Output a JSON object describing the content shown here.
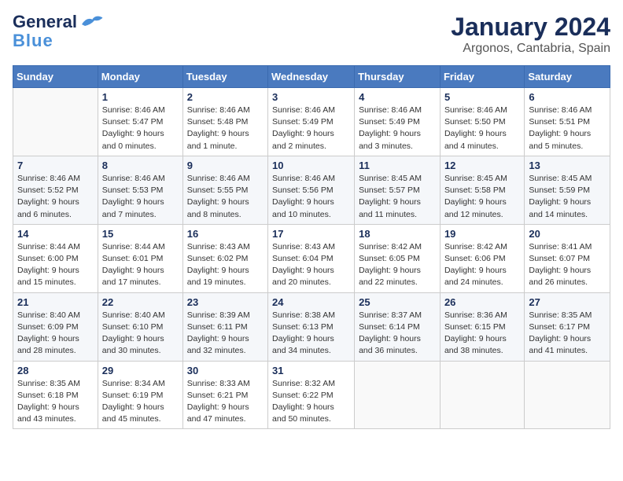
{
  "logo": {
    "line1": "General",
    "line2": "Blue"
  },
  "header": {
    "month": "January 2024",
    "location": "Argonos, Cantabria, Spain"
  },
  "weekdays": [
    "Sunday",
    "Monday",
    "Tuesday",
    "Wednesday",
    "Thursday",
    "Friday",
    "Saturday"
  ],
  "weeks": [
    [
      {
        "day": "",
        "info": ""
      },
      {
        "day": "1",
        "info": "Sunrise: 8:46 AM\nSunset: 5:47 PM\nDaylight: 9 hours\nand 0 minutes."
      },
      {
        "day": "2",
        "info": "Sunrise: 8:46 AM\nSunset: 5:48 PM\nDaylight: 9 hours\nand 1 minute."
      },
      {
        "day": "3",
        "info": "Sunrise: 8:46 AM\nSunset: 5:49 PM\nDaylight: 9 hours\nand 2 minutes."
      },
      {
        "day": "4",
        "info": "Sunrise: 8:46 AM\nSunset: 5:49 PM\nDaylight: 9 hours\nand 3 minutes."
      },
      {
        "day": "5",
        "info": "Sunrise: 8:46 AM\nSunset: 5:50 PM\nDaylight: 9 hours\nand 4 minutes."
      },
      {
        "day": "6",
        "info": "Sunrise: 8:46 AM\nSunset: 5:51 PM\nDaylight: 9 hours\nand 5 minutes."
      }
    ],
    [
      {
        "day": "7",
        "info": "Sunrise: 8:46 AM\nSunset: 5:52 PM\nDaylight: 9 hours\nand 6 minutes."
      },
      {
        "day": "8",
        "info": "Sunrise: 8:46 AM\nSunset: 5:53 PM\nDaylight: 9 hours\nand 7 minutes."
      },
      {
        "day": "9",
        "info": "Sunrise: 8:46 AM\nSunset: 5:55 PM\nDaylight: 9 hours\nand 8 minutes."
      },
      {
        "day": "10",
        "info": "Sunrise: 8:46 AM\nSunset: 5:56 PM\nDaylight: 9 hours\nand 10 minutes."
      },
      {
        "day": "11",
        "info": "Sunrise: 8:45 AM\nSunset: 5:57 PM\nDaylight: 9 hours\nand 11 minutes."
      },
      {
        "day": "12",
        "info": "Sunrise: 8:45 AM\nSunset: 5:58 PM\nDaylight: 9 hours\nand 12 minutes."
      },
      {
        "day": "13",
        "info": "Sunrise: 8:45 AM\nSunset: 5:59 PM\nDaylight: 9 hours\nand 14 minutes."
      }
    ],
    [
      {
        "day": "14",
        "info": "Sunrise: 8:44 AM\nSunset: 6:00 PM\nDaylight: 9 hours\nand 15 minutes."
      },
      {
        "day": "15",
        "info": "Sunrise: 8:44 AM\nSunset: 6:01 PM\nDaylight: 9 hours\nand 17 minutes."
      },
      {
        "day": "16",
        "info": "Sunrise: 8:43 AM\nSunset: 6:02 PM\nDaylight: 9 hours\nand 19 minutes."
      },
      {
        "day": "17",
        "info": "Sunrise: 8:43 AM\nSunset: 6:04 PM\nDaylight: 9 hours\nand 20 minutes."
      },
      {
        "day": "18",
        "info": "Sunrise: 8:42 AM\nSunset: 6:05 PM\nDaylight: 9 hours\nand 22 minutes."
      },
      {
        "day": "19",
        "info": "Sunrise: 8:42 AM\nSunset: 6:06 PM\nDaylight: 9 hours\nand 24 minutes."
      },
      {
        "day": "20",
        "info": "Sunrise: 8:41 AM\nSunset: 6:07 PM\nDaylight: 9 hours\nand 26 minutes."
      }
    ],
    [
      {
        "day": "21",
        "info": "Sunrise: 8:40 AM\nSunset: 6:09 PM\nDaylight: 9 hours\nand 28 minutes."
      },
      {
        "day": "22",
        "info": "Sunrise: 8:40 AM\nSunset: 6:10 PM\nDaylight: 9 hours\nand 30 minutes."
      },
      {
        "day": "23",
        "info": "Sunrise: 8:39 AM\nSunset: 6:11 PM\nDaylight: 9 hours\nand 32 minutes."
      },
      {
        "day": "24",
        "info": "Sunrise: 8:38 AM\nSunset: 6:13 PM\nDaylight: 9 hours\nand 34 minutes."
      },
      {
        "day": "25",
        "info": "Sunrise: 8:37 AM\nSunset: 6:14 PM\nDaylight: 9 hours\nand 36 minutes."
      },
      {
        "day": "26",
        "info": "Sunrise: 8:36 AM\nSunset: 6:15 PM\nDaylight: 9 hours\nand 38 minutes."
      },
      {
        "day": "27",
        "info": "Sunrise: 8:35 AM\nSunset: 6:17 PM\nDaylight: 9 hours\nand 41 minutes."
      }
    ],
    [
      {
        "day": "28",
        "info": "Sunrise: 8:35 AM\nSunset: 6:18 PM\nDaylight: 9 hours\nand 43 minutes."
      },
      {
        "day": "29",
        "info": "Sunrise: 8:34 AM\nSunset: 6:19 PM\nDaylight: 9 hours\nand 45 minutes."
      },
      {
        "day": "30",
        "info": "Sunrise: 8:33 AM\nSunset: 6:21 PM\nDaylight: 9 hours\nand 47 minutes."
      },
      {
        "day": "31",
        "info": "Sunrise: 8:32 AM\nSunset: 6:22 PM\nDaylight: 9 hours\nand 50 minutes."
      },
      {
        "day": "",
        "info": ""
      },
      {
        "day": "",
        "info": ""
      },
      {
        "day": "",
        "info": ""
      }
    ]
  ]
}
